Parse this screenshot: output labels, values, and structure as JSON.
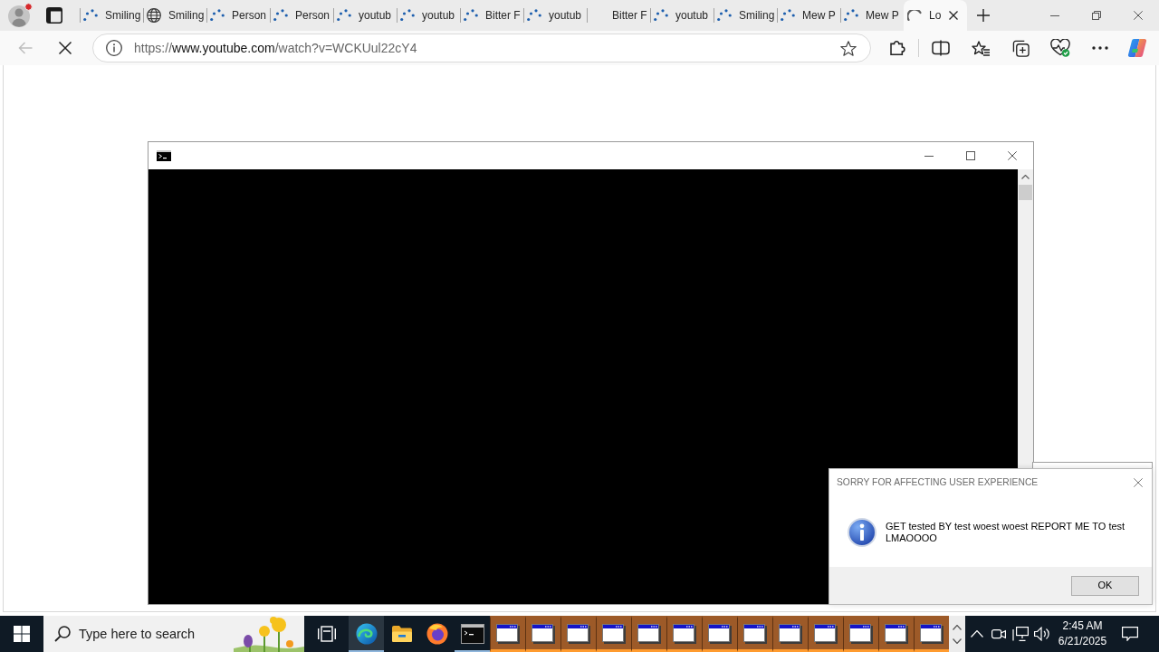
{
  "browser": {
    "tabs": [
      {
        "title": "Smiling",
        "kind": "loading",
        "selected": false
      },
      {
        "title": "Smiling",
        "kind": "globe",
        "selected": false
      },
      {
        "title": "Person",
        "kind": "loading",
        "selected": false
      },
      {
        "title": "Person",
        "kind": "loading",
        "selected": false
      },
      {
        "title": "youtub",
        "kind": "loading",
        "selected": false
      },
      {
        "title": "youtub",
        "kind": "loading",
        "selected": false
      },
      {
        "title": "Bitter F",
        "kind": "loading",
        "selected": false
      },
      {
        "title": "youtub",
        "kind": "loading",
        "selected": false
      },
      {
        "title": "Bitter F",
        "kind": "blank",
        "selected": false
      },
      {
        "title": "youtub",
        "kind": "loading",
        "selected": false
      },
      {
        "title": "Smiling",
        "kind": "loading",
        "selected": false
      },
      {
        "title": "Mew P",
        "kind": "loading",
        "selected": false
      },
      {
        "title": "Mew P",
        "kind": "loading",
        "selected": false
      },
      {
        "title": "Lo",
        "kind": "loading",
        "selected": true
      }
    ],
    "address": {
      "scheme": "https://",
      "host": "www.youtube.com",
      "path": "/watch?v=WCKUul22cY4"
    }
  },
  "dialog": {
    "title": "SORRY FOR AFFECTING USER EXPERIENCE",
    "message": "GET tested BY test woest woest REPORT ME TO test LMAOOOO",
    "buttons": [
      "OK"
    ]
  },
  "taskbar": {
    "search": {
      "placeholder": "Type here to search"
    },
    "pinned": [
      {
        "kind": "edge",
        "selected": true,
        "running": true
      },
      {
        "kind": "explorer",
        "selected": false,
        "running": false
      },
      {
        "kind": "firefox",
        "selected": false,
        "running": false
      },
      {
        "kind": "console",
        "selected": false,
        "running": true
      }
    ],
    "window_buttons": [
      {
        "flashing": true
      },
      {
        "flashing": true
      },
      {
        "flashing": true
      },
      {
        "flashing": true
      },
      {
        "flashing": true
      },
      {
        "flashing": true
      },
      {
        "flashing": true
      },
      {
        "flashing": true
      },
      {
        "flashing": true
      },
      {
        "flashing": true
      },
      {
        "flashing": true
      },
      {
        "flashing": true
      },
      {
        "flashing": true
      }
    ],
    "clock": {
      "time": "2:45 AM",
      "date": "6/21/2025"
    }
  }
}
